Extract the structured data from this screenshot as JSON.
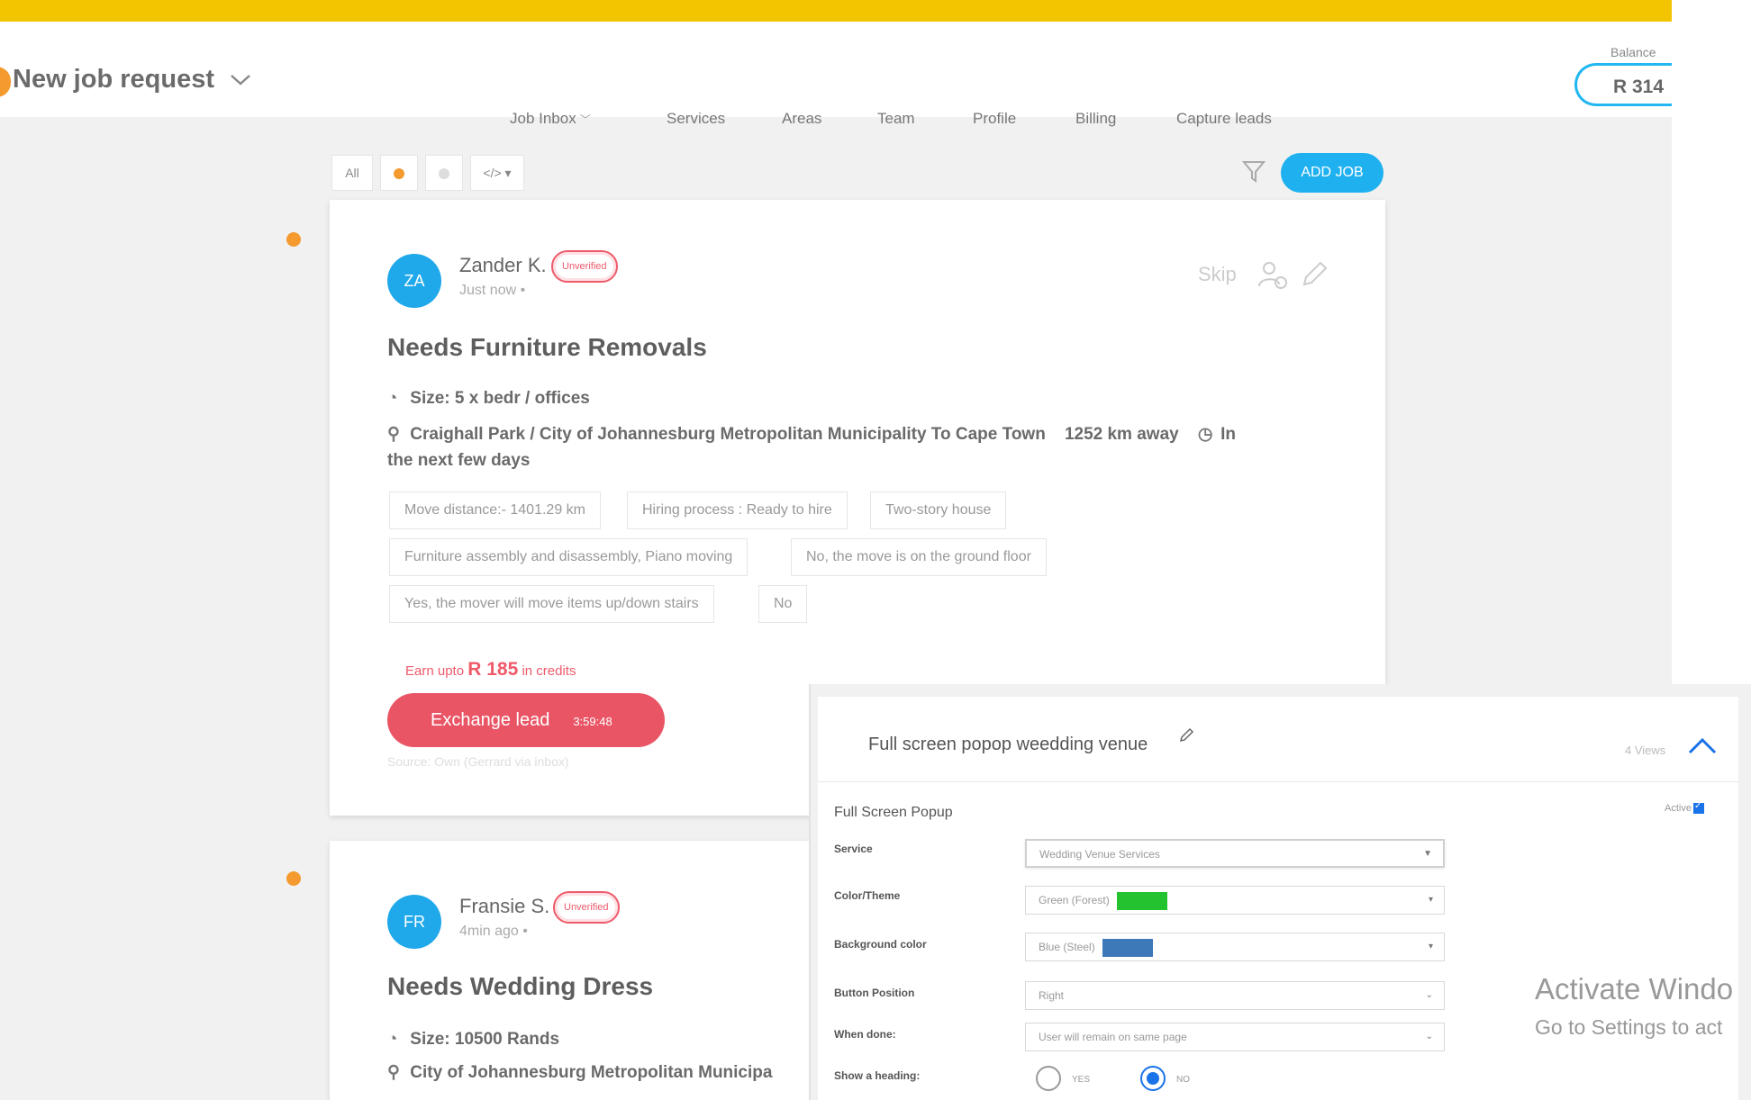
{
  "header": {
    "title": "New job request",
    "balance_label": "Balance",
    "balance_value": "R 314",
    "nav": [
      "Job Inbox",
      "Services",
      "Areas",
      "Team",
      "Profile",
      "Billing",
      "Capture leads"
    ]
  },
  "filters": {
    "all_label": "All",
    "code_label": "</> ▾",
    "add_job_label": "ADD JOB"
  },
  "cards": [
    {
      "initials": "ZA",
      "name": "Zander K.",
      "badge": "Unverified",
      "time": "Just now",
      "skip_label": "Skip",
      "title": "Needs Furniture Removals",
      "size": "Size: 5 x bedr / offices",
      "route": "Craighall Park / City of Johannesburg Metropolitan Municipality To Cape Town",
      "distance": "1252 km away",
      "when_1": "In",
      "when_2": "the next few days",
      "tags": [
        "Move distance:- 1401.29 km",
        "Hiring process : Ready to hire",
        "Two-story house",
        "Furniture assembly and disassembly, Piano moving",
        "No, the move is on the ground floor",
        "Yes, the mover will move items up/down stairs",
        "No"
      ],
      "earn_prefix": "Earn upto",
      "earn_amount": "R 185",
      "earn_suffix": "in credits",
      "exchange_label": "Exchange lead",
      "exchange_timer": "3:59:48",
      "source": "Source: Own (Gerrard via inbox)"
    },
    {
      "initials": "FR",
      "name": "Fransie S.",
      "badge": "Unverified",
      "time": "4min ago",
      "title": "Needs Wedding Dress",
      "size": "Size: 10500 Rands",
      "route": "City of Johannesburg Metropolitan Municipa"
    }
  ],
  "popup": {
    "title": "Full screen popop weedding venue",
    "views": "4 Views",
    "subtitle": "Full Screen Popup",
    "active_label": "Active",
    "fields": [
      {
        "label": "Service",
        "value": "Wedding Venue Services"
      },
      {
        "label": "Color/Theme",
        "value": "Green (Forest)",
        "swatch": "#22c32e"
      },
      {
        "label": "Background color",
        "value": "Blue (Steel)",
        "swatch": "#3d78b8"
      },
      {
        "label": "Button Position",
        "value": "Right"
      },
      {
        "label": "When done:",
        "value": "User will remain on same page"
      },
      {
        "label": "Show a heading:"
      }
    ],
    "radio_yes": "YES",
    "radio_no": "NO",
    "radio_selected": "NO"
  },
  "watermark": {
    "line1": "Activate Windo",
    "line2": "Go to Settings to act"
  },
  "colors": {
    "brand_yellow": "#f2c500",
    "accent_blue": "#1fb1ef",
    "lead_red": "#e95565",
    "timeline_orange": "#f49a2e"
  }
}
